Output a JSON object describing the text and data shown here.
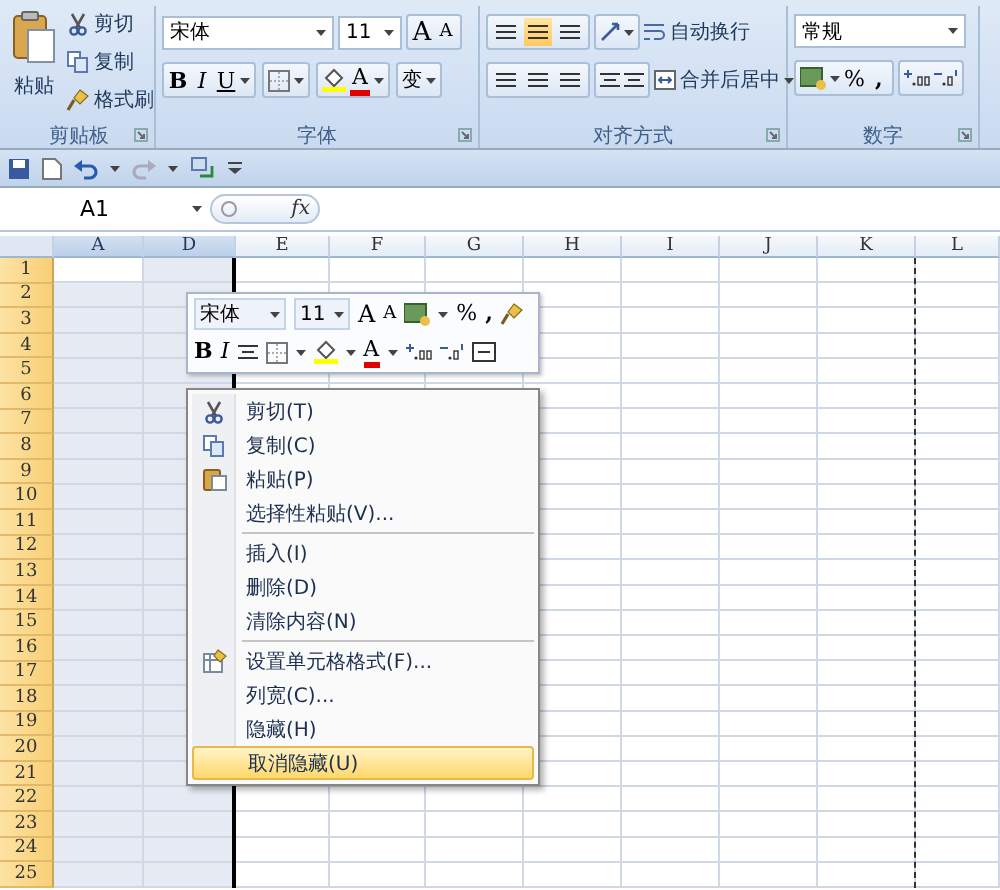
{
  "ribbon": {
    "groups": [
      {
        "kind": "clipboard",
        "label": "剪贴板",
        "paste": "粘贴",
        "items": [
          "剪切",
          "复制",
          "格式刷"
        ]
      },
      {
        "kind": "font",
        "label": "字体",
        "font": "宋体",
        "size": "11",
        "grow": "A",
        "shrink": "A",
        "styles": [
          "B",
          "I",
          "U"
        ],
        "font_color": "A",
        "phonetic": "变"
      },
      {
        "kind": "alignment",
        "label": "对齐方式",
        "valign": [
          {
            "selected": false
          },
          {
            "selected": true
          },
          {
            "selected": false
          }
        ],
        "wrap": "自动换行",
        "merge": "合并后居中"
      },
      {
        "kind": "number",
        "label": "数字",
        "format": "常规",
        "percent": "%",
        "comma": ","
      }
    ]
  },
  "formula_bar": {
    "name_box": "A1",
    "function_label": "fx"
  },
  "sheet": {
    "columns": [
      {
        "label": "A",
        "selected": true
      },
      {
        "label": "D",
        "selected": true
      },
      {
        "label": "E",
        "selected": false
      },
      {
        "label": "F",
        "selected": false
      },
      {
        "label": "G",
        "selected": false
      },
      {
        "label": "H",
        "selected": false
      },
      {
        "label": "I",
        "selected": false
      },
      {
        "label": "J",
        "selected": false
      },
      {
        "label": "K",
        "selected": false
      },
      {
        "label": "L",
        "selected": false
      }
    ],
    "rows": [
      "1",
      "2",
      "3",
      "4",
      "5",
      "6",
      "7",
      "8",
      "9",
      "10",
      "11",
      "12",
      "13",
      "14",
      "15",
      "16",
      "17",
      "18",
      "19",
      "20",
      "21",
      "22",
      "23",
      "24",
      "25"
    ]
  },
  "mini_toolbar": {
    "font": "宋体",
    "size": "11",
    "grow": "A",
    "shrink": "A",
    "percent": "%",
    "comma": ",",
    "bold": "B",
    "italic": "I",
    "font_color": "A"
  },
  "context_menu": {
    "items": [
      {
        "label": "剪切(T)",
        "separator_before": false,
        "selected": false
      },
      {
        "label": "复制(C)",
        "separator_before": false,
        "selected": false
      },
      {
        "label": "粘贴(P)",
        "separator_before": false,
        "selected": false
      },
      {
        "label": "选择性粘贴(V)...",
        "separator_before": false,
        "selected": false
      },
      {
        "label": "插入(I)",
        "separator_before": true,
        "selected": false
      },
      {
        "label": "删除(D)",
        "separator_before": false,
        "selected": false
      },
      {
        "label": "清除内容(N)",
        "separator_before": false,
        "selected": false
      },
      {
        "label": "设置单元格格式(F)...",
        "separator_before": true,
        "selected": false
      },
      {
        "label": "列宽(C)...",
        "separator_before": false,
        "selected": false
      },
      {
        "label": "隐藏(H)",
        "separator_before": false,
        "selected": false
      },
      {
        "label": "取消隐藏(U)",
        "separator_before": false,
        "selected": true
      }
    ]
  }
}
